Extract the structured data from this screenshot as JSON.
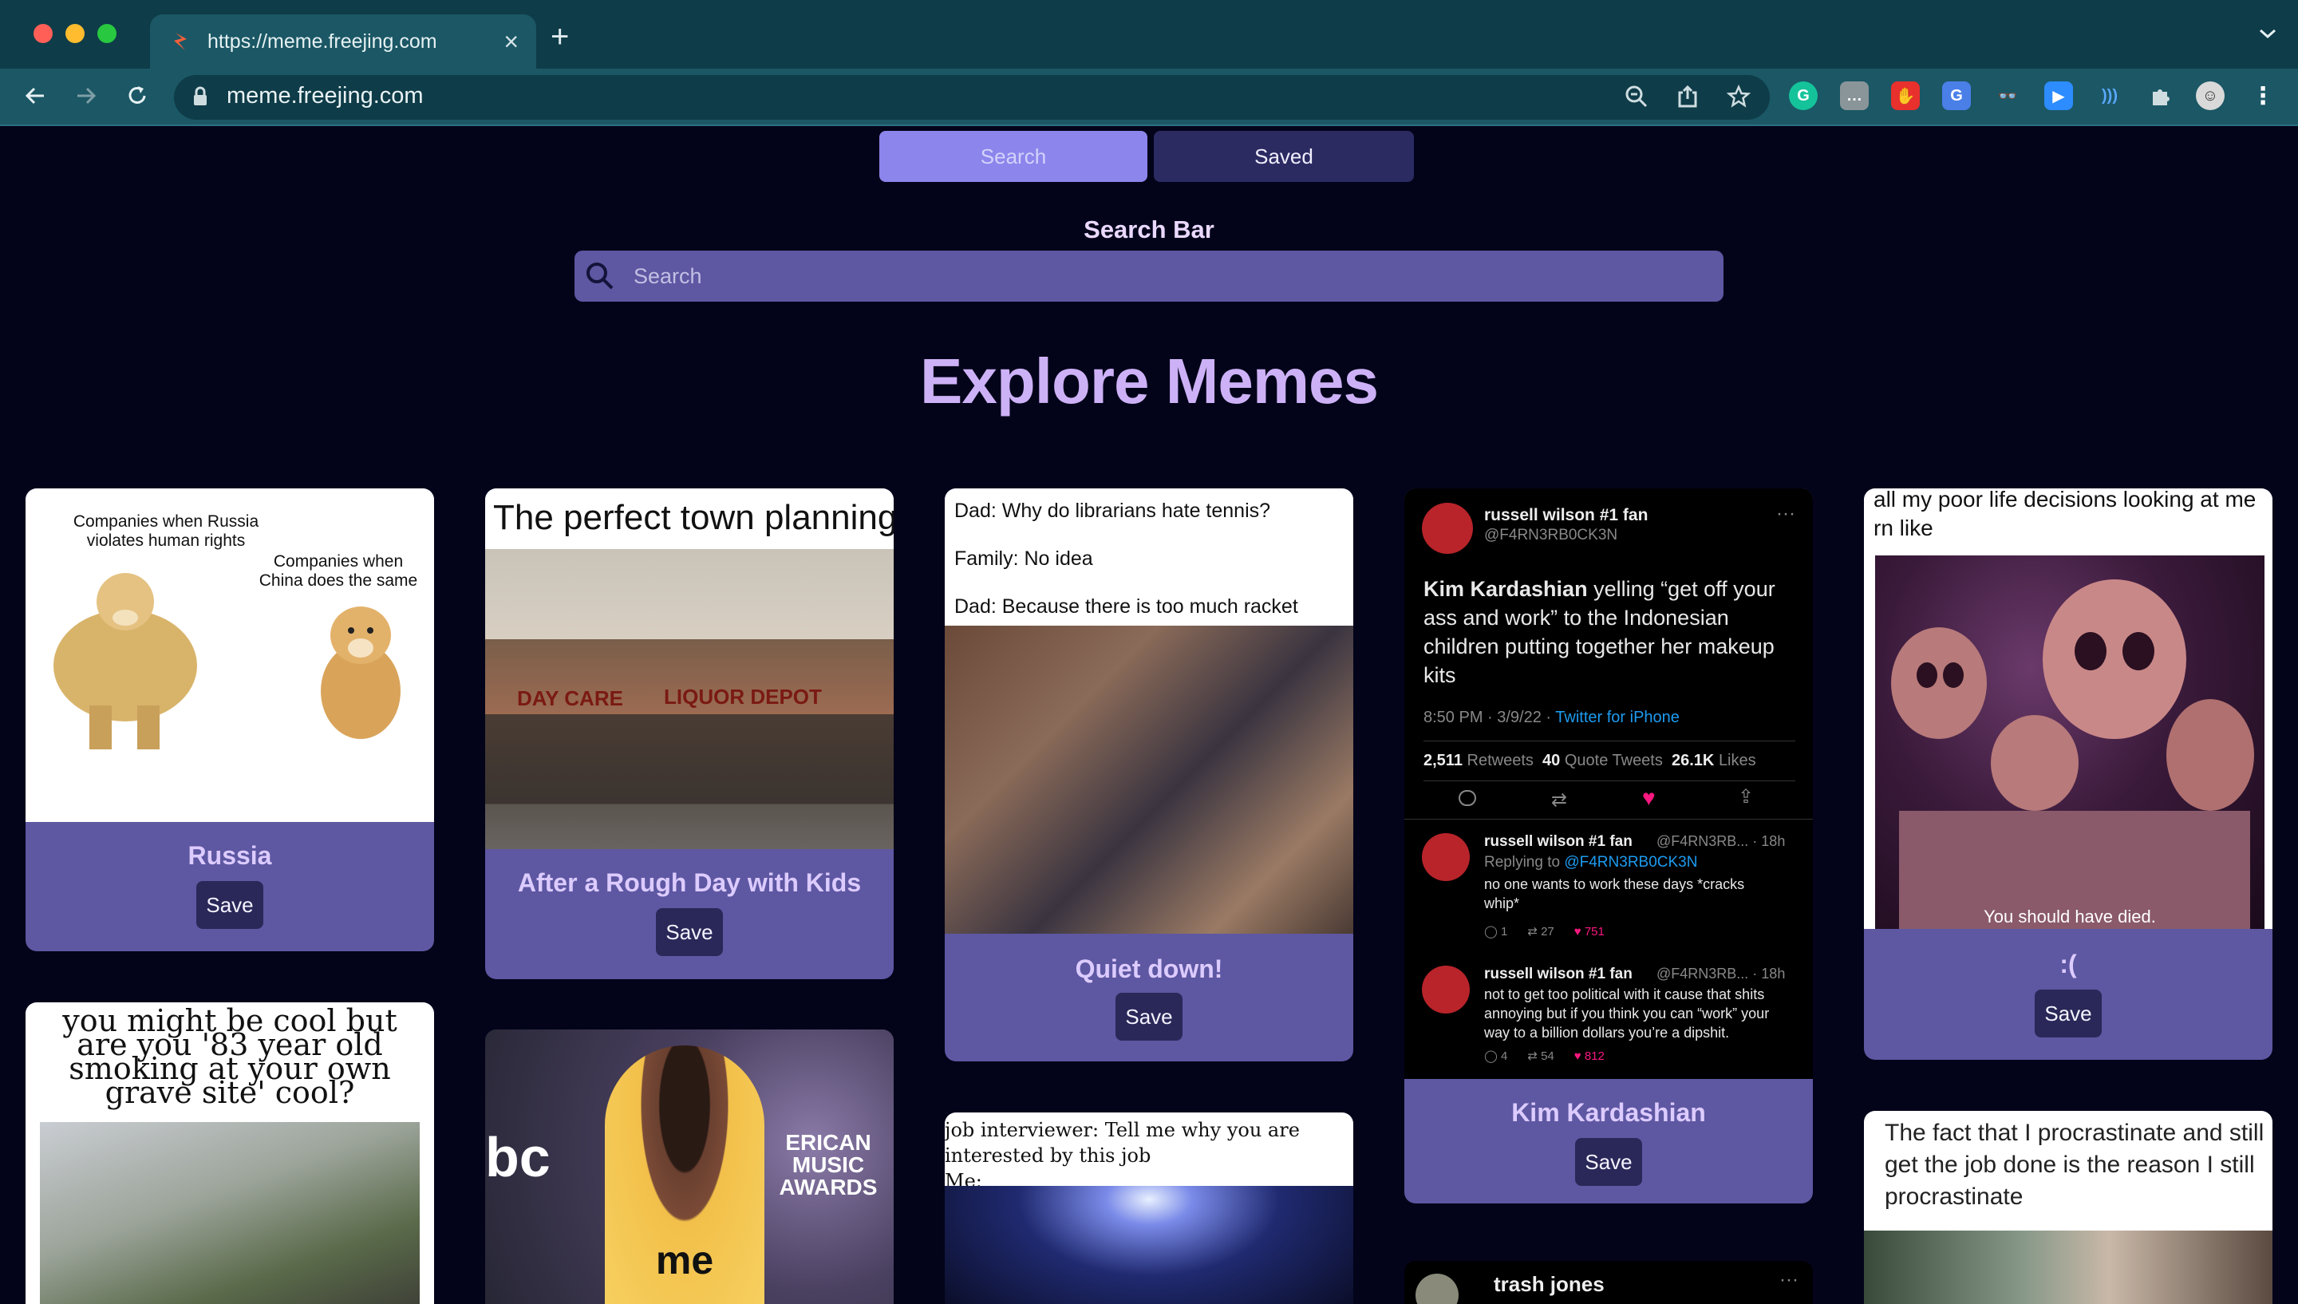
{
  "browser": {
    "tab_title": "https://meme.freejing.com",
    "url": "meme.freejing.com"
  },
  "nav": {
    "search_label": "Search",
    "saved_label": "Saved"
  },
  "search": {
    "label": "Search Bar",
    "placeholder": "Search"
  },
  "heading": "Explore Memes",
  "save_label": "Save",
  "cards": [
    {
      "title": "Russia",
      "meme_text": [
        "Companies when Russia",
        "violates human rights",
        "Companies when",
        "China does the same"
      ]
    },
    {
      "title": "After a Rough Day with Kids",
      "meme_text": [
        "The perfect town planning",
        "DAY CARE",
        "LIQUOR DEPOT"
      ]
    },
    {
      "title": "Quiet down!",
      "meme_text": [
        "Dad: Why do librarians hate tennis?",
        "Family: No idea",
        "Dad: Because there is too much racket"
      ]
    },
    {
      "title": "Kim Kardashian",
      "tweet": {
        "name": "russell wilson #1 fan",
        "handle": "@F4RN3RB0CK3N",
        "body_bold": "Kim Kardashian",
        "body_lines": [
          "yelling “get off your",
          "ass and work” to the Indonesian",
          "children putting together her makeup",
          "kits"
        ],
        "time": "8:50 PM · 3/9/22 · ",
        "source": "Twitter for iPhone",
        "retweets": "2,511",
        "retweets_label": "Retweets",
        "quotes": "40",
        "quotes_label": "Quote Tweets",
        "likes": "26.1K",
        "likes_label": "Likes",
        "replies": [
          {
            "name": "russell wilson #1 fan",
            "meta": "@F4RN3RB... · 18h",
            "replying": "Replying to ",
            "replying_to": "@F4RN3RB0CK3N",
            "lines": [
              "no one wants to work these days *cracks",
              "whip*"
            ],
            "c": "1",
            "r": "27",
            "l": "751"
          },
          {
            "name": "russell wilson #1 fan",
            "meta": "@F4RN3RB... · 18h",
            "lines": [
              "not to get too political with it cause that shits",
              "annoying but if you think you can “work” your",
              "way to a billion dollars you’re a dipshit."
            ],
            "c": "4",
            "r": "54",
            "l": "812"
          }
        ]
      }
    },
    {
      "title": ":(",
      "meme_text": [
        "all my poor life decisions looking at me",
        "rn like",
        "You should have died."
      ]
    }
  ],
  "row2": {
    "card1_text": [
      "you might be cool but",
      "are you '83 year old",
      "smoking at your own",
      "grave site' cool?"
    ],
    "card2_text": [
      "me"
    ],
    "card2_logo": [
      "ERICAN",
      "MUSIC",
      "AWARDS"
    ],
    "card2_abc": "bc",
    "card3_text": [
      "job interviewer: Tell me why you are",
      "interested by this job",
      "Me:"
    ],
    "card4_name": "trash jones",
    "card5_text": [
      "The fact that I procrastinate and still",
      "get the job done is the reason I still",
      "procrastinate"
    ]
  }
}
